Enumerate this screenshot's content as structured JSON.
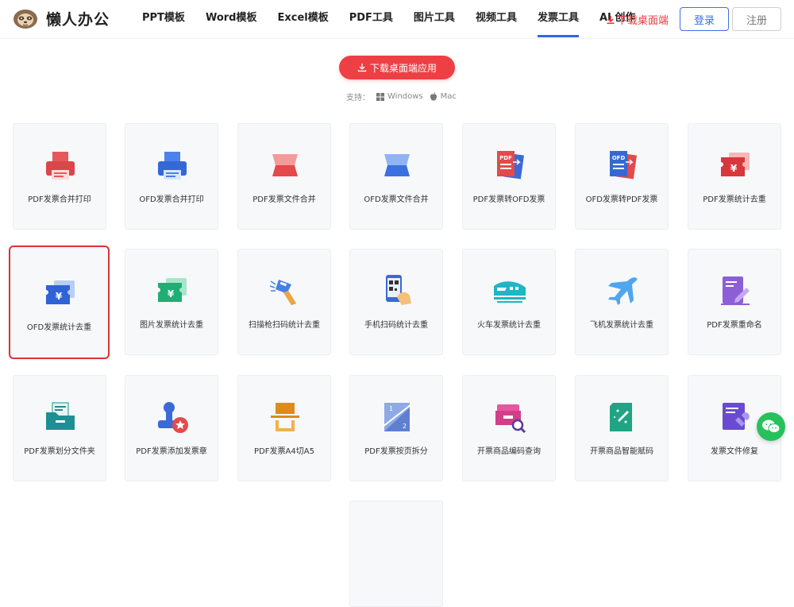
{
  "brand": {
    "name": "懒人办公"
  },
  "nav": [
    {
      "label": "PPT模板",
      "active": false
    },
    {
      "label": "Word模板",
      "active": false
    },
    {
      "label": "Excel模板",
      "active": false
    },
    {
      "label": "PDF工具",
      "active": false
    },
    {
      "label": "图片工具",
      "active": false
    },
    {
      "label": "视频工具",
      "active": false
    },
    {
      "label": "发票工具",
      "active": true
    },
    {
      "label": "AI 创作",
      "active": false
    }
  ],
  "header": {
    "download_label": "下载桌面端",
    "login_label": "登录",
    "register_label": "注册"
  },
  "cta": {
    "label": "下载桌面端应用"
  },
  "support": {
    "label": "支持：",
    "windows": "Windows",
    "mac": "Mac"
  },
  "tools": [
    {
      "label": "PDF发票合并打印",
      "icon": "red-printer-icon"
    },
    {
      "label": "OFD发票合并打印",
      "icon": "blue-printer-icon"
    },
    {
      "label": "PDF发票文件合并",
      "icon": "red-merge-icon"
    },
    {
      "label": "OFD发票文件合并",
      "icon": "blue-merge-icon"
    },
    {
      "label": "PDF发票转OFD发票",
      "icon": "pdf-to-ofd-icon"
    },
    {
      "label": "OFD发票转PDF发票",
      "icon": "ofd-to-pdf-icon"
    },
    {
      "label": "PDF发票统计去重",
      "icon": "red-invoice-dedupe-icon"
    },
    {
      "label": "OFD发票统计去重",
      "icon": "blue-invoice-dedupe-icon"
    },
    {
      "label": "图片发票统计去重",
      "icon": "green-invoice-dedupe-icon"
    },
    {
      "label": "扫描枪扫码统计去重",
      "icon": "barcode-scanner-icon"
    },
    {
      "label": "手机扫码统计去重",
      "icon": "phone-scan-icon"
    },
    {
      "label": "火车发票统计去重",
      "icon": "train-icon"
    },
    {
      "label": "飞机发票统计去重",
      "icon": "airplane-icon"
    },
    {
      "label": "PDF发票重命名",
      "icon": "rename-icon"
    },
    {
      "label": "PDF发票划分文件夹",
      "icon": "folder-split-icon"
    },
    {
      "label": "PDF发票添加发票章",
      "icon": "stamp-icon"
    },
    {
      "label": "PDF发票A4切A5",
      "icon": "a4-cut-a5-icon"
    },
    {
      "label": "PDF发票按页拆分",
      "icon": "page-split-icon"
    },
    {
      "label": "开票商品编码查询",
      "icon": "code-search-icon"
    },
    {
      "label": "开票商品智能赋码",
      "icon": "smart-code-icon"
    },
    {
      "label": "发票文件修复",
      "icon": "file-repair-icon"
    },
    {
      "label": "",
      "icon": ""
    }
  ],
  "colors": {
    "accent_red": "#ee3f44",
    "accent_blue": "#3d6fe8",
    "nav_underline": "#3366dd",
    "selected_border": "#d9343a",
    "wechat_green": "#27c15b"
  }
}
